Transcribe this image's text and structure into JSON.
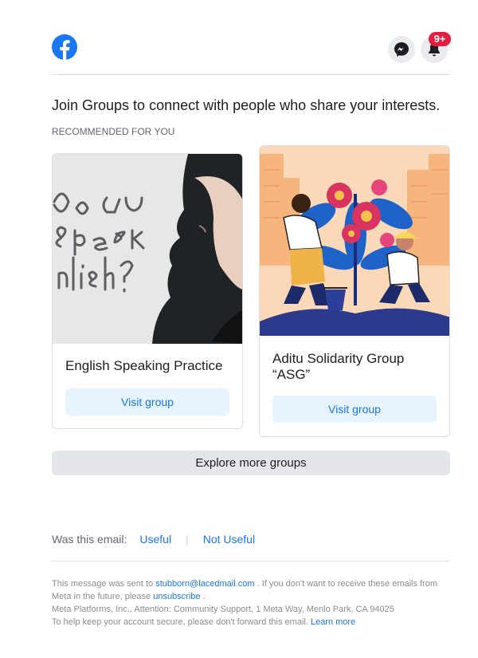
{
  "header": {
    "logo_icon": "facebook-logo-icon",
    "messenger_icon": "messenger-icon",
    "notifications_icon": "bell-icon",
    "notification_badge": "9+",
    "brand_color": "#1877f2"
  },
  "main": {
    "headline": "Join Groups to connect with people who share your interests.",
    "section_label": "RECOMMENDED FOR YOU",
    "groups": [
      {
        "name": "English Speaking Practice",
        "button": "Visit group"
      },
      {
        "name": "Aditu Solidarity Group “ASG”",
        "button": "Visit group"
      }
    ],
    "explore_button": "Explore more groups"
  },
  "feedback": {
    "prompt": "Was this email:",
    "useful": "Useful",
    "separator": "|",
    "not_useful": "Not Useful"
  },
  "footer": {
    "line1_prefix": "This message was sent to",
    "email": "stubborn@lacedmail.com",
    "line1_suffix": ". If you don't want to receive these emails from Meta in the future, please",
    "unsubscribe": "unsubscribe",
    "period": ".",
    "address": "Meta Platforms, Inc., Attention: Community Support, 1 Meta Way, Menlo Park, CA 94025",
    "security_note": "To help keep your account secure, please don't forward this email.",
    "learn_more": "Learn more"
  }
}
